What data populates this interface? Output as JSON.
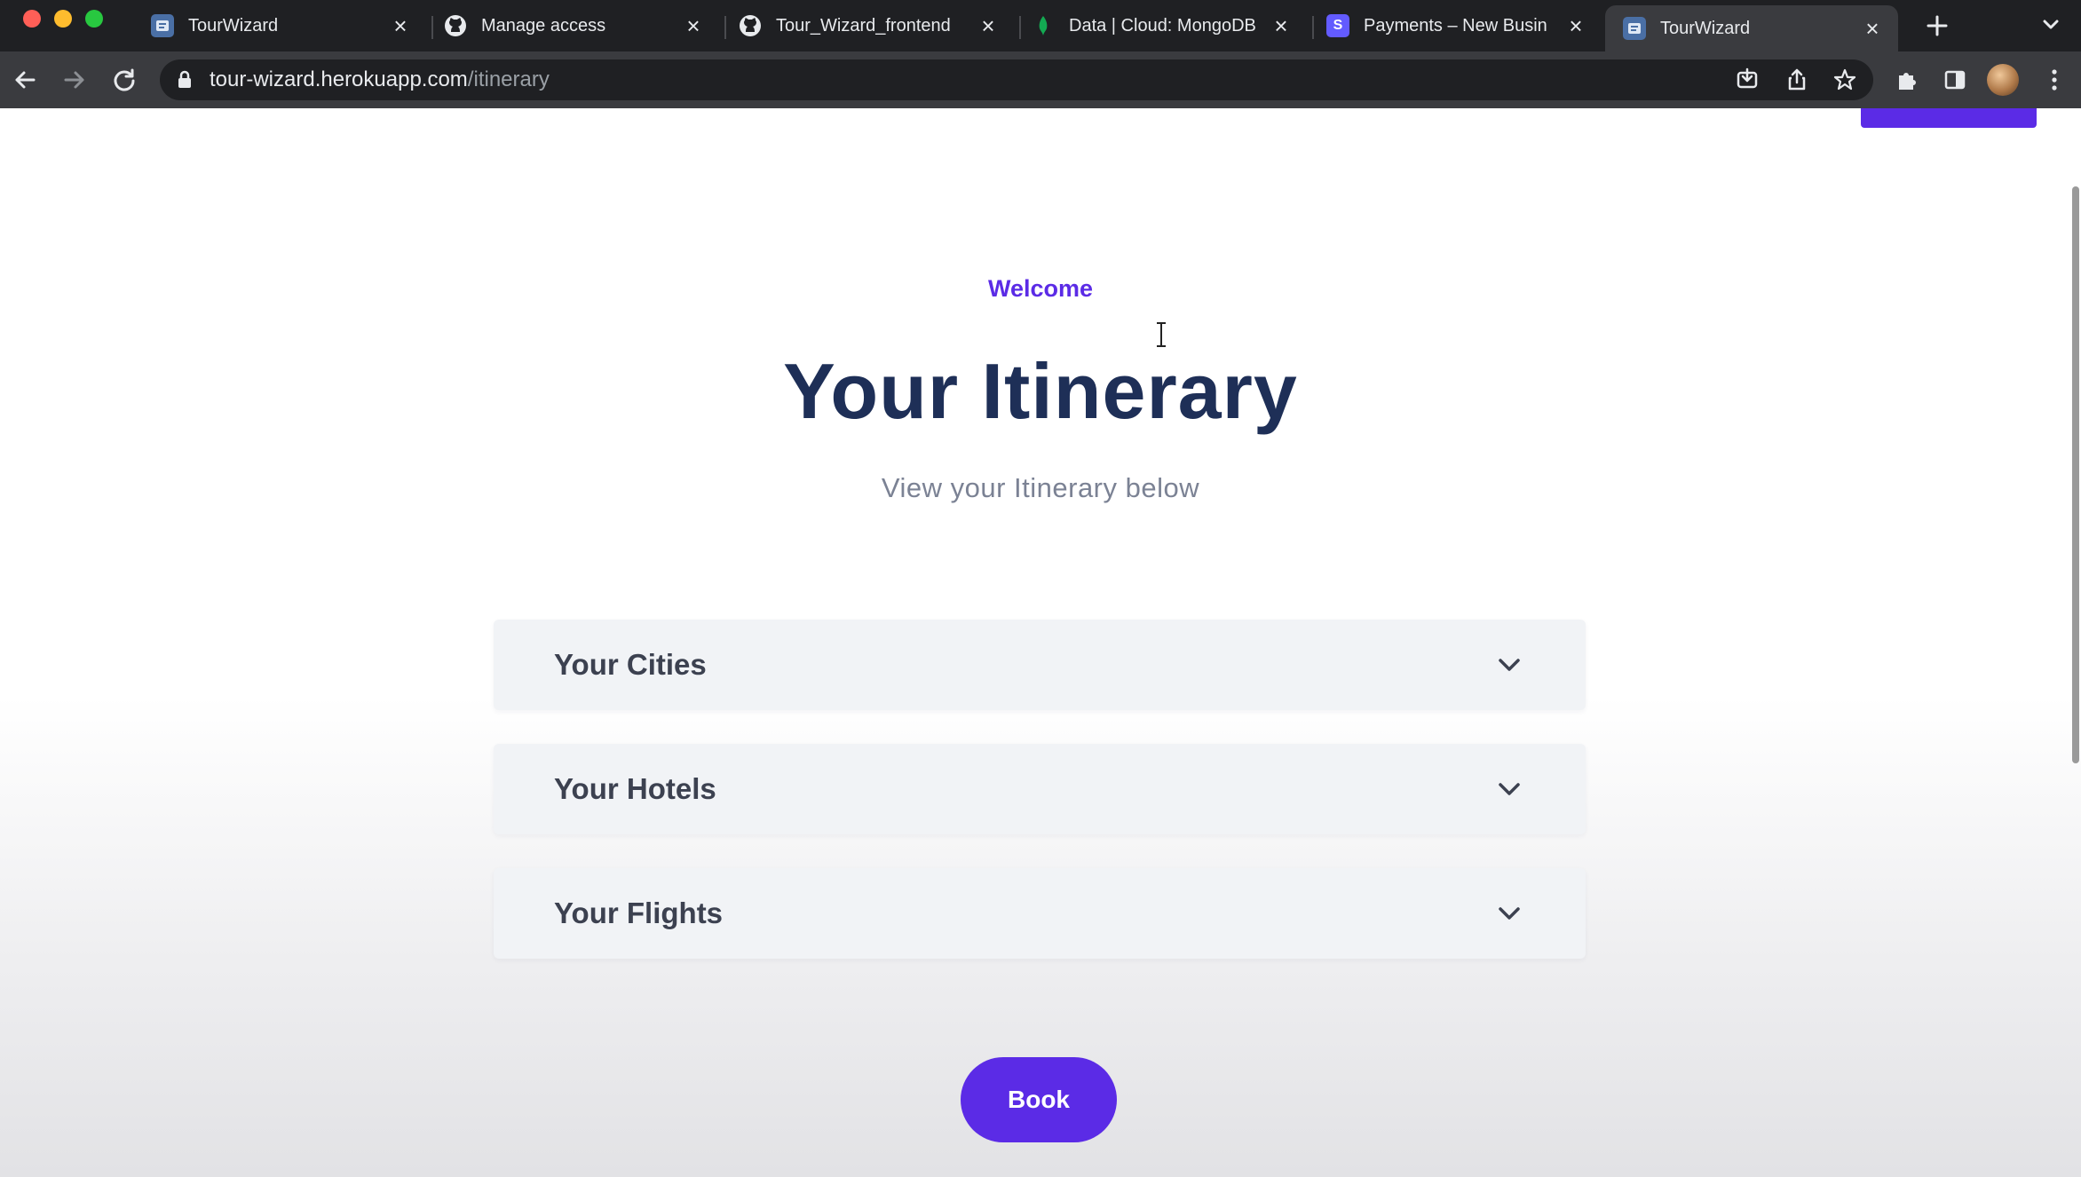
{
  "browser": {
    "tabs": [
      {
        "title": "TourWizard",
        "favicon": "tourwizard-favicon",
        "active": false
      },
      {
        "title": "Manage access",
        "favicon": "github-favicon",
        "active": false
      },
      {
        "title": "Tour_Wizard_frontend",
        "favicon": "github-favicon",
        "active": false
      },
      {
        "title": "Data | Cloud: MongoDB",
        "favicon": "mongodb-favicon",
        "active": false
      },
      {
        "title": "Payments – New Busin",
        "favicon": "stripe-favicon",
        "active": false
      },
      {
        "title": "TourWizard",
        "favicon": "tourwizard-favicon",
        "active": true
      }
    ],
    "stripe_letter": "S",
    "url_host": "tour-wizard.herokuapp.com",
    "url_path": "/itinerary"
  },
  "page": {
    "eyebrow": "Welcome",
    "title": "Your Itinerary",
    "subtitle": "View your Itinerary below",
    "sections": [
      {
        "label": "Your Cities",
        "expanded": false
      },
      {
        "label": "Your Hotels",
        "expanded": false
      },
      {
        "label": "Your Flights",
        "expanded": false
      }
    ],
    "book_label": "Book"
  },
  "colors": {
    "accent": "#5b2be6",
    "heading": "#1e2f57",
    "subtitle": "#7b8294",
    "accordion_bg": "#f1f3f6"
  }
}
